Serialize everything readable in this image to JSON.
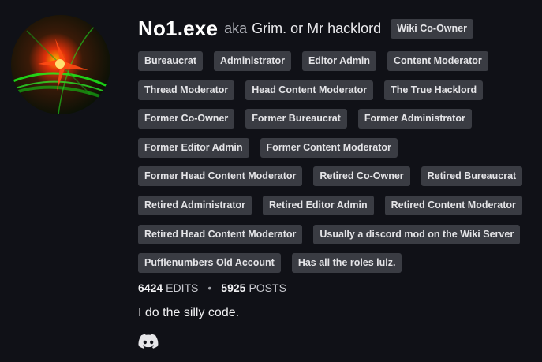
{
  "profile": {
    "username": "No1.exe",
    "aka_label": "aka",
    "aka_names": "Grim. or Mr hacklord",
    "primary_badge": "Wiki Co-Owner",
    "badge_rows": [
      [
        "Bureaucrat",
        "Administrator",
        "Editor Admin",
        "Content Moderator"
      ],
      [
        "Thread Moderator",
        "Head Content Moderator",
        "The True Hacklord"
      ],
      [
        "Former Co-Owner",
        "Former Bureaucrat",
        "Former Administrator"
      ],
      [
        "Former Editor Admin",
        "Former Content Moderator"
      ],
      [
        "Former Head Content Moderator",
        "Retired Co-Owner",
        "Retired Bureaucrat"
      ],
      [
        "Retired Administrator",
        "Retired Editor Admin",
        "Retired Content Moderator"
      ],
      [
        "Retired Head Content Moderator",
        "Usually a discord mod on the Wiki Server"
      ],
      [
        "Pufflenumbers Old Account",
        "Has all the roles lulz."
      ]
    ],
    "stats": {
      "edits_count": "6424",
      "edits_label": "EDITS",
      "separator": "•",
      "posts_count": "5925",
      "posts_label": "POSTS"
    },
    "bio": "I do the silly code.",
    "social_icon": "discord-icon"
  }
}
